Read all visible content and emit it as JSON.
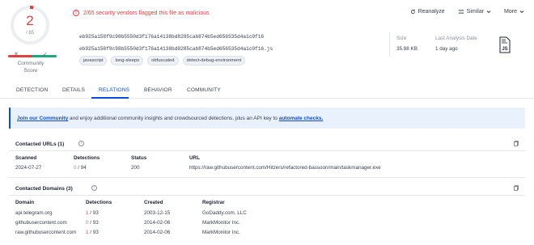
{
  "score": {
    "detections": "2",
    "total": "/ 65",
    "label": "Community Score",
    "x_mark": "✕",
    "check_mark": "✓"
  },
  "alert": {
    "text": "2/65 security vendors flagged this file as malicious"
  },
  "actions": {
    "reanalyze": "Reanalyze",
    "similar": "Similar",
    "more": "More"
  },
  "file": {
    "hash1": "eb925a158f9c98b5550d3f176a14138bd8285cab874b5ed656535d4a1c0f16",
    "hash2": "eb925a158f9c98b5550d3f176a14138bd8285cab874b5ed656535d4a1c0f16.js",
    "tags": [
      "javascript",
      "long-sleeps",
      "obfuscated",
      "detect-debug-environment"
    ],
    "size_label": "Size",
    "size_value": "35.98 KB",
    "date_label": "Last Analysis Date",
    "date_value": "1 day ago",
    "type_label": "JS"
  },
  "tabs": [
    "DETECTION",
    "DETAILS",
    "RELATIONS",
    "BEHAVIOR",
    "COMMUNITY"
  ],
  "banner": {
    "link1": "Join our Community",
    "middle": " and enjoy additional community insights and crowdsourced detections, plus an API key to ",
    "link2": "automate checks."
  },
  "contacted_urls": {
    "title": "Contacted URLs",
    "count": "(1)",
    "headers": [
      "Scanned",
      "Detections",
      "Status",
      "URL"
    ],
    "rows": [
      {
        "scanned": "2024-07-27",
        "det_num": "0",
        "det_total": " / 94",
        "status": "200",
        "url": "https://raw.githubusercontent.com/Hitzers/refactored-bassoon/main/taskmanager.exe"
      }
    ]
  },
  "contacted_domains": {
    "title": "Contacted Domains",
    "count": "(3)",
    "headers": [
      "Domain",
      "Detections",
      "Created",
      "Registrar"
    ],
    "rows": [
      {
        "domain": "api.telegram.org",
        "det_num": "1",
        "det_total": " / 93",
        "created": "2003-12-15",
        "registrar": "GoDaddy.com, LLC"
      },
      {
        "domain": "githubusercontent.com",
        "det_num": "0",
        "det_total": " / 93",
        "created": "2014-02-06",
        "registrar": "MarkMonitor Inc."
      },
      {
        "domain": "raw.githubusercontent.com",
        "det_num": "1",
        "det_total": " / 93",
        "created": "2014-02-06",
        "registrar": "MarkMonitor Inc."
      }
    ]
  },
  "colors": {
    "accent": "#0b4dda",
    "danger": "#e04141",
    "safe": "#1ea77a"
  }
}
